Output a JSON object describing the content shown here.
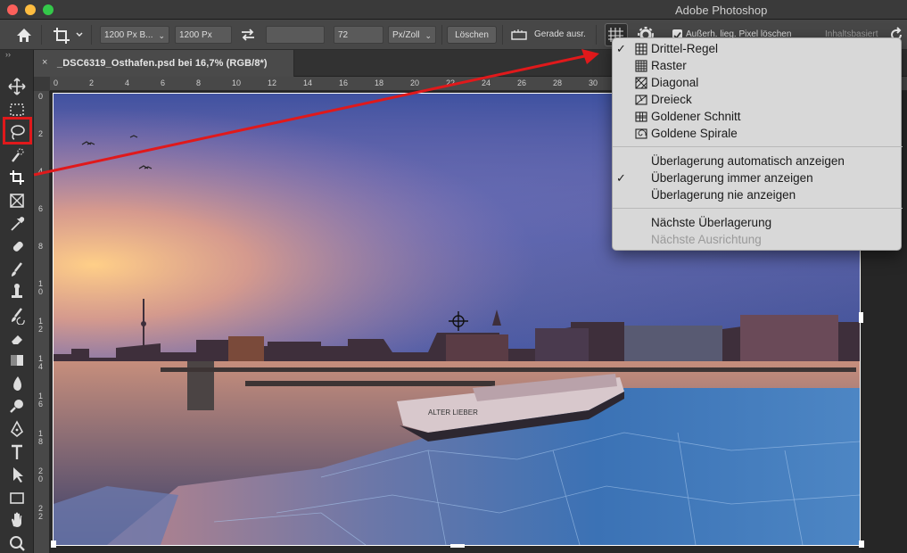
{
  "window": {
    "title": "Adobe Photoshop"
  },
  "options_bar": {
    "ratio_value": "1200 Px B...",
    "width_value": "1200 Px",
    "height_value": "",
    "resolution_value": "72",
    "resolution_unit": "Px/Zoll",
    "clear_label": "Löschen",
    "straighten_label": "Gerade ausr.",
    "delete_cropped_label": "Außerh. lieg. Pixel löschen",
    "content_aware_label": "Inhaltsbasiert"
  },
  "document_tab": {
    "close": "×",
    "title": "_DSC6319_Osthafen.psd bei 16,7% (RGB/8*)"
  },
  "ruler": {
    "h_ticks": [
      "0",
      "2",
      "4",
      "6",
      "8",
      "10",
      "12",
      "14",
      "16",
      "18",
      "20",
      "22",
      "24",
      "26",
      "28",
      "30"
    ],
    "v_ticks": [
      "0",
      "2",
      "4",
      "6",
      "8",
      "1\n0",
      "1\n2",
      "1\n4",
      "1\n6",
      "1\n8",
      "2\n0",
      "2\n2"
    ]
  },
  "overlay_menu": {
    "items": [
      {
        "label": "Drittel-Regel",
        "checked": true,
        "icon": "thirds-grid-icon"
      },
      {
        "label": "Raster",
        "checked": false,
        "icon": "grid-icon"
      },
      {
        "label": "Diagonal",
        "checked": false,
        "icon": "diagonal-icon"
      },
      {
        "label": "Dreieck",
        "checked": false,
        "icon": "triangle-icon"
      },
      {
        "label": "Goldener Schnitt",
        "checked": false,
        "icon": "golden-ratio-icon"
      },
      {
        "label": "Goldene Spirale",
        "checked": false,
        "icon": "golden-spiral-icon"
      }
    ],
    "display_options": [
      {
        "label": "Überlagerung automatisch anzeigen",
        "checked": false
      },
      {
        "label": "Überlagerung immer anzeigen",
        "checked": true
      },
      {
        "label": "Überlagerung nie anzeigen",
        "checked": false
      }
    ],
    "cycle_options": [
      {
        "label": "Nächste Überlagerung",
        "enabled": true
      },
      {
        "label": "Nächste Ausrichtung",
        "enabled": false
      }
    ],
    "check_mark": "✓"
  },
  "tools": [
    "move-tool-icon",
    "marquee-tool-icon",
    "lasso-tool-icon",
    "quick-selection-tool-icon",
    "crop-tool-icon",
    "frame-tool-icon",
    "eyedropper-tool-icon",
    "healing-brush-tool-icon",
    "brush-tool-icon",
    "clone-stamp-tool-icon",
    "history-brush-tool-icon",
    "eraser-tool-icon",
    "gradient-tool-icon",
    "blur-tool-icon",
    "dodge-tool-icon",
    "pen-tool-icon",
    "type-tool-icon",
    "path-selection-tool-icon",
    "rectangle-tool-icon",
    "hand-tool-icon",
    "zoom-tool-icon"
  ],
  "photo_caption": "ALTER LIEBER",
  "colors": {
    "highlight": "#e0191b",
    "menu_bg": "#d8d8d8",
    "app_bg": "#262626"
  }
}
